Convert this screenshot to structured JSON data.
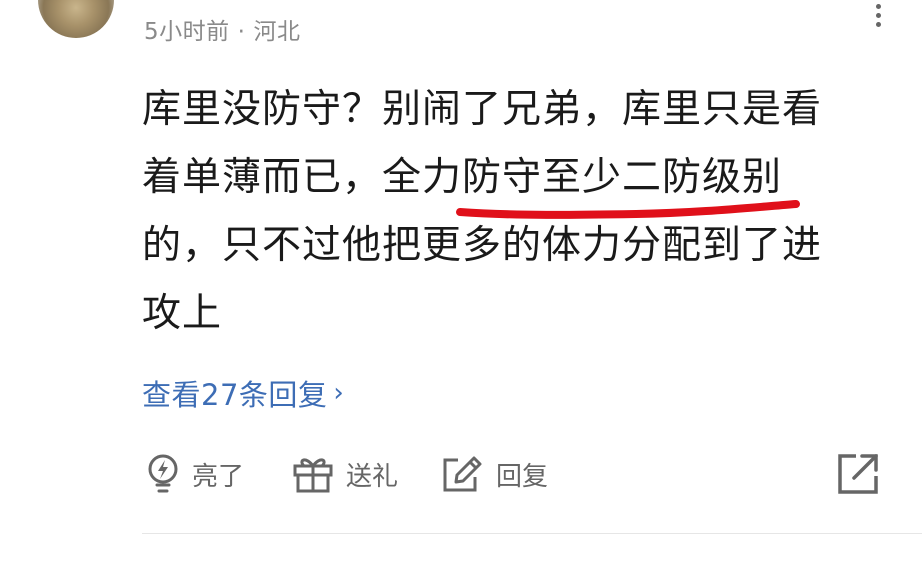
{
  "header": {
    "time_ago": "5小时前",
    "separator": "·",
    "location": "河北"
  },
  "comment": {
    "lines": [
      "库里没防守？别闹了兄弟，库里只是看",
      "着单薄而已，全力防守至少二防级别",
      "的，只不过他把更多的体力分配到了进",
      "攻上"
    ],
    "highlight_color": "#e0101a"
  },
  "replies": {
    "label": "查看27条回复",
    "chevron": "›",
    "color": "#3d6db5"
  },
  "actions": {
    "like_label": "亮了",
    "gift_label": "送礼",
    "reply_label": "回复",
    "like_icon": "lightning-bulb-icon",
    "gift_icon": "gift-icon",
    "reply_icon": "edit-icon",
    "share_icon": "share-icon"
  }
}
